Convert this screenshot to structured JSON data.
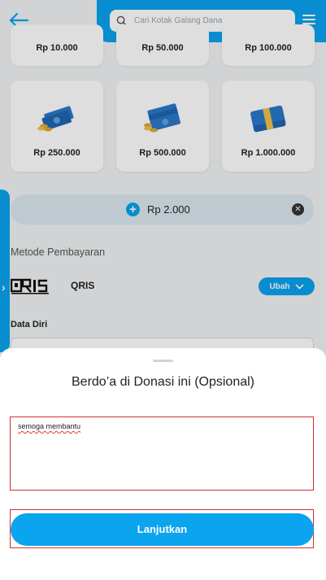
{
  "header": {
    "search_placeholder": "Cari Kotak Galang Dana"
  },
  "donation_options": [
    {
      "label": "Rp 10.000"
    },
    {
      "label": "Rp 50.000"
    },
    {
      "label": "Rp 100.000"
    },
    {
      "label": "Rp 250.000",
      "icon": "money-bills-coins-icon"
    },
    {
      "label": "Rp 500.000",
      "icon": "money-stack-coins-icon"
    },
    {
      "label": "Rp 1.000.000",
      "icon": "money-bundle-icon"
    }
  ],
  "custom_amount": {
    "value": "Rp 2.000"
  },
  "payment": {
    "section_title": "Metode Pembayaran",
    "method_label": "QRIS",
    "change_button": "Ubah"
  },
  "personal_data": {
    "section_title": "Data Diri"
  },
  "sheet": {
    "title": "Berdo’a di Donasi ini (Opsional)",
    "prayer_value": "semoga membantu",
    "submit_label": "Lanjutkan"
  },
  "colors": {
    "primary": "#0aa4ef",
    "highlight_border": "#d32f2f",
    "money_green": "#2a79c9"
  }
}
